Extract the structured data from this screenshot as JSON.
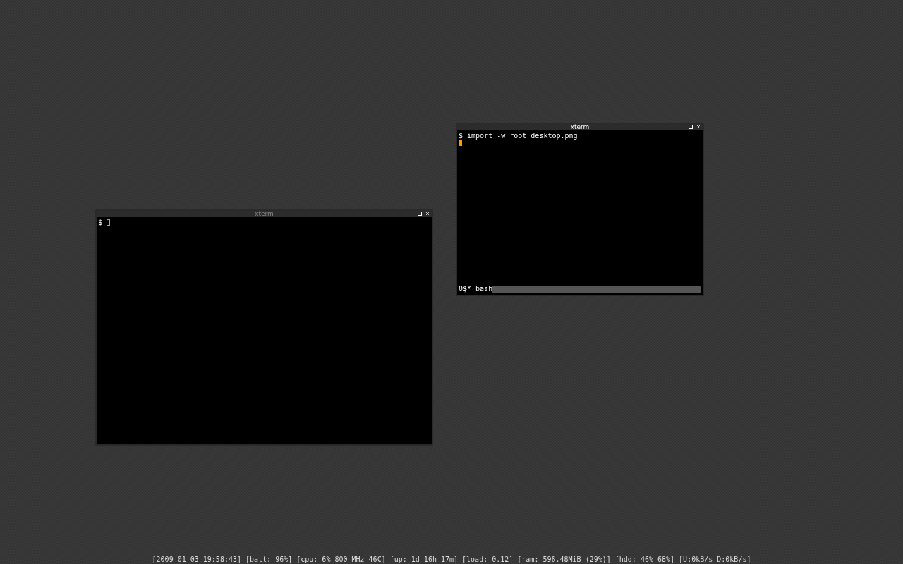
{
  "windows": [
    {
      "title": "xterm",
      "focused": true,
      "lines": [
        "$ import -w root desktop.png"
      ],
      "status_line": "0$* bash"
    },
    {
      "title": "xterm",
      "focused": false,
      "prompt": "$"
    }
  ],
  "status_bar": "[2009-01-03 19:58:43] [batt: 96%] [cpu: 6% 800 MHz 46C] [up: 1d 16h 17m] [load: 0.12] [ram: 596.48MiB (29%)] [hdd: 46% 68%] [U:0kB/s D:0kB/s]"
}
